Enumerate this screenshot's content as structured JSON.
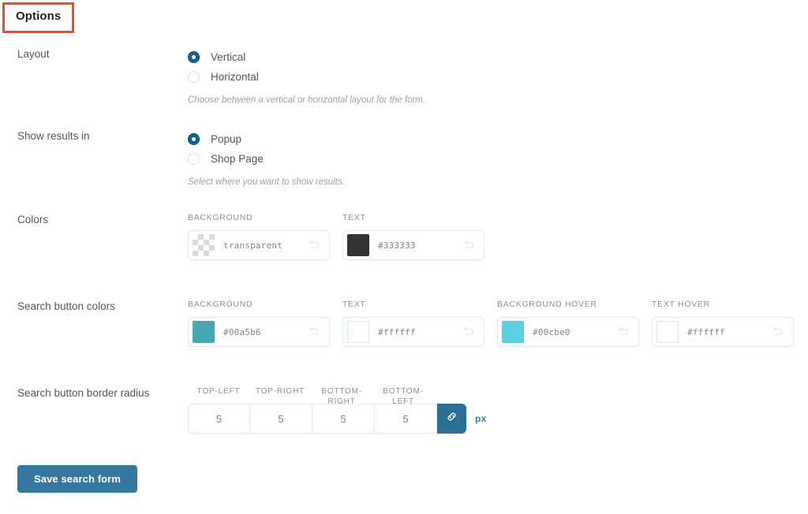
{
  "panel": {
    "title": "Options"
  },
  "rows": {
    "layout": {
      "label": "Layout",
      "options": [
        {
          "label": "Vertical",
          "selected": true
        },
        {
          "label": "Horizontal",
          "selected": false
        }
      ],
      "hint": "Choose between a vertical or horizontal layout for the form."
    },
    "show_results": {
      "label": "Show results in",
      "options": [
        {
          "label": "Popup",
          "selected": true
        },
        {
          "label": "Shop Page",
          "selected": false
        }
      ],
      "hint": "Select where you want to show results."
    },
    "colors": {
      "label": "Colors",
      "fields": [
        {
          "head": "BACKGROUND",
          "value": "transparent",
          "swatch": "checkerboard"
        },
        {
          "head": "TEXT",
          "value": "#333333",
          "swatch": "#333333"
        }
      ]
    },
    "search_button_colors": {
      "label": "Search button colors",
      "fields": [
        {
          "head": "BACKGROUND",
          "value": "#00a5b6",
          "swatch": "#4aa7b4"
        },
        {
          "head": "TEXT",
          "value": "#ffffff",
          "swatch": "#ffffff"
        },
        {
          "head": "BACKGROUND HOVER",
          "value": "#00cbe0",
          "swatch": "#5ccfe1"
        },
        {
          "head": "TEXT HOVER",
          "value": "#ffffff",
          "swatch": "#ffffff"
        }
      ]
    },
    "border_radius": {
      "label": "Search button border radius",
      "heads": [
        "TOP-LEFT",
        "TOP-RIGHT",
        "BOTTOM-RIGHT",
        "BOTTOM-LEFT"
      ],
      "values": [
        "5",
        "5",
        "5",
        "5"
      ],
      "unit": "px",
      "link_icon": "link-icon"
    }
  },
  "save": {
    "label": "Save search form"
  },
  "theme": {
    "accent": "#35789f",
    "radio_on": "#13628d",
    "link_btn": "#2b6f93",
    "highlight_outline": "#f04a28"
  }
}
